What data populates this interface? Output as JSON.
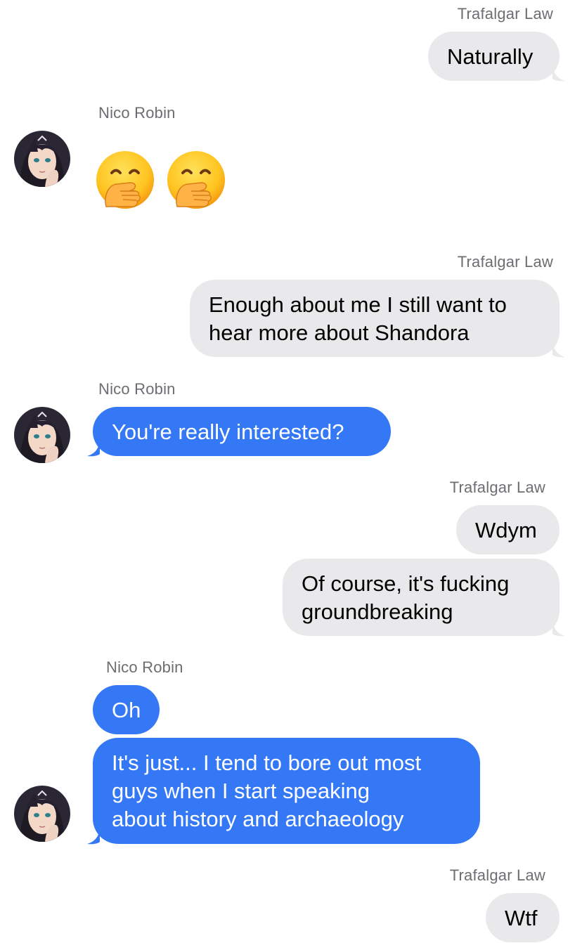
{
  "conversation": {
    "messages": [
      {
        "sender": "Trafalgar Law",
        "text": "Naturally"
      },
      {
        "sender": "Nico Robin",
        "emoji": [
          "face-with-hand-over-mouth-emoji",
          "face-with-hand-over-mouth-emoji"
        ]
      },
      {
        "sender": "Trafalgar Law",
        "lines": [
          "Enough about me I still want to",
          "hear more about Shandora"
        ]
      },
      {
        "sender": "Nico Robin",
        "text": "You're really interested?"
      },
      {
        "sender": "Trafalgar Law",
        "text": "Wdym"
      },
      {
        "sender": "Trafalgar Law",
        "lines": [
          "Of course, it's fucking",
          "groundbreaking"
        ]
      },
      {
        "sender": "Nico Robin",
        "text": "Oh"
      },
      {
        "sender": "Nico Robin",
        "lines": [
          "It's just... I tend to bore out most",
          "guys when I start speaking",
          "about history and archaeology"
        ]
      },
      {
        "sender": "Trafalgar Law",
        "text": "Wtf"
      }
    ]
  },
  "colors": {
    "incoming_bubble": "#3478f6",
    "outgoing_bubble": "#e9e9eb",
    "sender_name": "#6d6d72"
  }
}
